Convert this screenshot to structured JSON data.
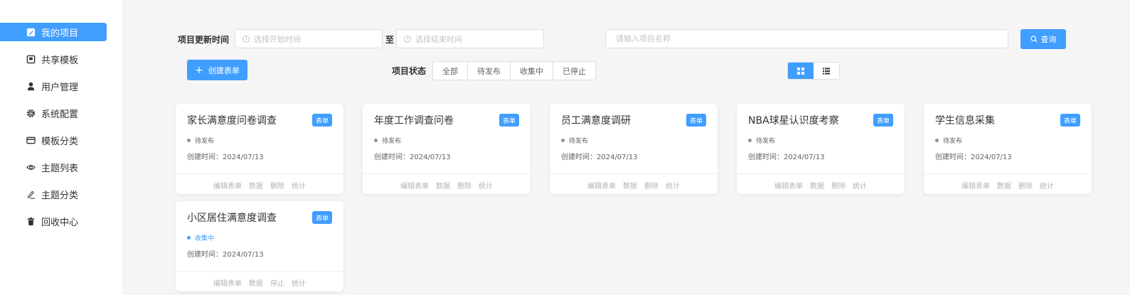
{
  "sidebar": {
    "items": [
      {
        "label": "我的项目",
        "icon": "edit-icon",
        "active": true
      },
      {
        "label": "共享模板",
        "icon": "template-icon",
        "active": false
      },
      {
        "label": "用户管理",
        "icon": "user-icon",
        "active": false
      },
      {
        "label": "系统配置",
        "icon": "gear-icon",
        "active": false
      },
      {
        "label": "模板分类",
        "icon": "card-icon",
        "active": false
      },
      {
        "label": "主题列表",
        "icon": "eye-icon",
        "active": false
      },
      {
        "label": "主题分类",
        "icon": "pen-icon",
        "active": false
      },
      {
        "label": "回收中心",
        "icon": "trash-icon",
        "active": false
      }
    ]
  },
  "filters": {
    "update_time_label": "项目更新时间",
    "start_placeholder": "选择开始时间",
    "range_separator": "至",
    "end_placeholder": "选择结束时间",
    "name_placeholder": "请输入项目名称",
    "search_button": "查询",
    "create_button": "创建表单",
    "status_label": "项目状态",
    "status_options": [
      "全部",
      "待发布",
      "收集中",
      "已停止"
    ]
  },
  "colors": {
    "primary": "#409eff",
    "pending_dot": "#909399",
    "collecting": "#409eff"
  },
  "cards": [
    {
      "title": "家长满意度问卷调查",
      "tag": "表单",
      "status": "待发布",
      "date": "创建时间：2024/07/13",
      "actions": [
        "编辑表单",
        "数据",
        "删除",
        "统计"
      ]
    },
    {
      "title": "年度工作调查问卷",
      "tag": "表单",
      "status": "待发布",
      "date": "创建时间：2024/07/13",
      "actions": [
        "编辑表单",
        "数据",
        "删除",
        "统计"
      ]
    },
    {
      "title": "员工满意度调研",
      "tag": "表单",
      "status": "待发布",
      "date": "创建时间：2024/07/13",
      "actions": [
        "编辑表单",
        "数据",
        "删除",
        "统计"
      ]
    },
    {
      "title": "NBA球星认识度考察",
      "tag": "表单",
      "status": "待发布",
      "date": "创建时间：2024/07/13",
      "actions": [
        "编辑表单",
        "数据",
        "删除",
        "统计"
      ]
    },
    {
      "title": "学生信息采集",
      "tag": "表单",
      "status": "待发布",
      "date": "创建时间：2024/07/13",
      "actions": [
        "编辑表单",
        "数据",
        "删除",
        "统计"
      ]
    },
    {
      "title": "小区居住满意度调查",
      "tag": "表单",
      "status": "收集中",
      "date": "创建时间：2024/07/13",
      "actions": [
        "编辑表单",
        "数据",
        "停止",
        "统计"
      ]
    }
  ]
}
